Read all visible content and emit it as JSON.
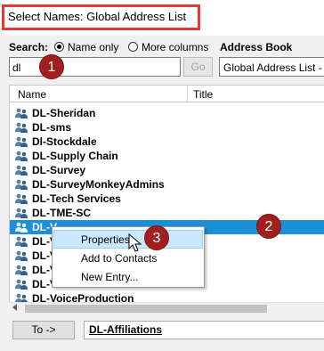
{
  "window": {
    "title": "Select Names: Global Address List"
  },
  "search": {
    "label": "Search:",
    "value": "dl",
    "options": [
      {
        "label": "Name only",
        "checked": true
      },
      {
        "label": "More columns",
        "checked": false
      }
    ],
    "go_label": "Go"
  },
  "address_book": {
    "label": "Address Book",
    "value": "Global Address List - I"
  },
  "list": {
    "columns": [
      "Name",
      "Title"
    ],
    "rows": [
      {
        "name": "DL-Sheridan"
      },
      {
        "name": "DL-sms"
      },
      {
        "name": "Dl-Stockdale"
      },
      {
        "name": "DL-Supply Chain"
      },
      {
        "name": "DL-Survey"
      },
      {
        "name": "DL-SurveyMonkeyAdmins"
      },
      {
        "name": "DL-Tech Services"
      },
      {
        "name": "DL-TME-SC"
      },
      {
        "name": "DL-V",
        "selected": true
      },
      {
        "name": "DL-V"
      },
      {
        "name": "DL-V"
      },
      {
        "name": "DL-V"
      },
      {
        "name": "DL-V"
      },
      {
        "name": "DL-VoiceProduction"
      }
    ]
  },
  "context_menu": {
    "items": [
      {
        "label": "Properties",
        "highlighted": true
      },
      {
        "label": "Add to Contacts"
      },
      {
        "label": "New Entry..."
      }
    ]
  },
  "to": {
    "button_label": "To ->",
    "value": "DL-Affiliations"
  },
  "callouts": [
    "1",
    "2",
    "3"
  ],
  "colors": {
    "highlight_box": "#e53935",
    "callout": "#a1201f",
    "selection": "#1c8fd9",
    "menu_highlight": "#cce8ff"
  },
  "icons": {
    "group": "group-contact-icon",
    "cursor": "mouse-pointer-icon"
  }
}
